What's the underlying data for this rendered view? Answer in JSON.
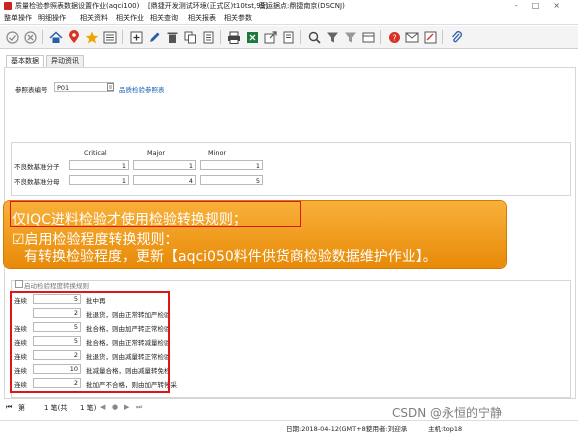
{
  "window": {
    "title": "质量检验参照表数据设置作业(aqci100)",
    "env": "[鼎捷开发测试环境(正式区)t10tst,99]",
    "user": "营运据点:鼎捷南京(DSCNJ)",
    "controls": [
      "-",
      "□",
      "×"
    ]
  },
  "menu": [
    "整单操作",
    "明细操作",
    "相关资料",
    "相关作业",
    "相关查询",
    "相关报表",
    "相关参数"
  ],
  "toolbar_icons": [
    "check-icon",
    "cancel-icon",
    "home-icon",
    "location-pin-icon",
    "star-icon",
    "list-icon",
    "add-icon",
    "edit-icon",
    "delete-icon",
    "copy-icon",
    "print-icon",
    "excel-icon",
    "export-icon",
    "search-icon",
    "filter-icon",
    "sort-icon",
    "field-icon",
    "help-icon",
    "mail-icon",
    "attach-icon"
  ],
  "tabs": [
    "基本数据",
    "异动资讯"
  ],
  "form": {
    "ref_label": "参照表编号",
    "ref_value": "P01",
    "ref_link": "品质检验参照表",
    "headers": [
      "Critical",
      "Major",
      "Minor"
    ],
    "row1_label": "不良数基准分子",
    "row2_label": "不良数基准分母",
    "row1_values": [
      "1",
      "1",
      "1"
    ],
    "row2_values": [
      "1",
      "4",
      "5"
    ]
  },
  "callout": {
    "line1": "仅IQC进料检验才使用检验转换规则；",
    "line2": "☑启用检验程度转换规则：",
    "line3": "有转换检验程度，更新【aqci050料件供货商检验数据维护作业】。"
  },
  "enable_checkbox_label": "启动检验程度转换规则",
  "rules": [
    {
      "prefix": "连续",
      "value": "5",
      "text": "批中再"
    },
    {
      "prefix": "",
      "value": "2",
      "text": "批退货，则由正常转加严检验"
    },
    {
      "prefix": "连续",
      "value": "5",
      "text": "批合格，则由加严转正常检验"
    },
    {
      "prefix": "连续",
      "value": "5",
      "text": "批合格，则由正常转减量检验"
    },
    {
      "prefix": "连续",
      "value": "2",
      "text": "批退货，则由减量转正常检验"
    },
    {
      "prefix": "连续",
      "value": "10",
      "text": "批减量合格，则由减量转免检"
    },
    {
      "prefix": "连续",
      "value": "2",
      "text": "批加严不合格，则由加严转停采"
    }
  ],
  "pager": {
    "first": "⏮",
    "prev": "◀",
    "label": "1 笔(共",
    "count": "1 笔)",
    "total_prefix": "第",
    "next": "▶",
    "last": "⏭",
    "circle": "●"
  },
  "status": {
    "date": "日期:2018-04-12(GMT+8)",
    "user": "使用者:刘迎承",
    "host": "主机:top18"
  },
  "watermark": "CSDN @永恒的宁静"
}
